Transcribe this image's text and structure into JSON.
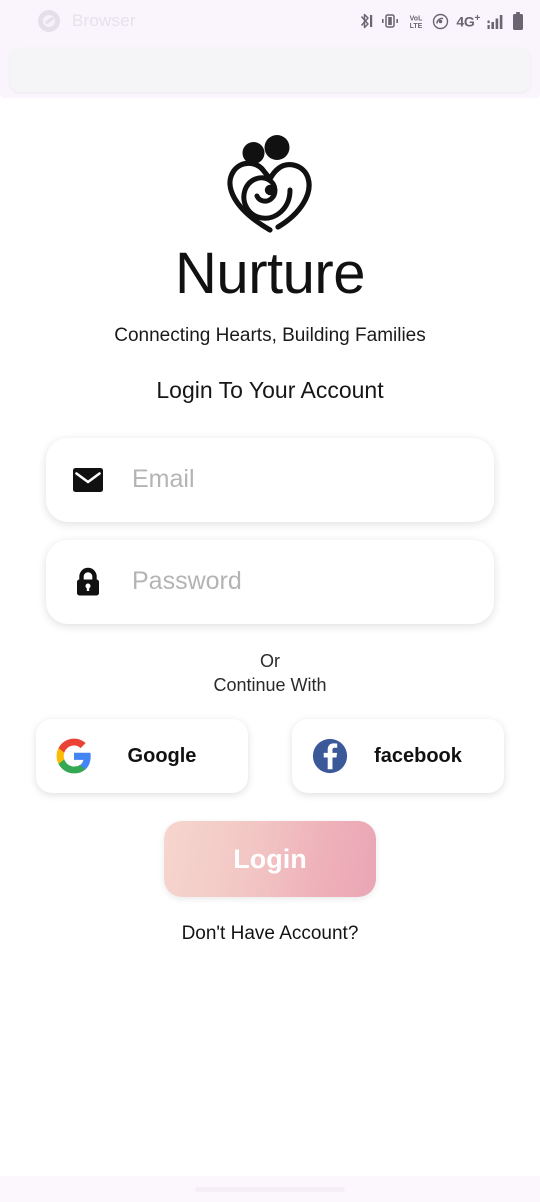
{
  "browser": {
    "label": "Browser",
    "compass_icon": "compass-icon",
    "url_bar_value": "",
    "url_bar_placeholder": "",
    "status_icons": [
      "bluetooth-off-icon",
      "vibrate-icon",
      "volte-icon",
      "hotspot-icon",
      "network-4g-plus-icon",
      "signal-bars-icon",
      "battery-icon"
    ],
    "network_label": "4G",
    "network_superscript": "+"
  },
  "app": {
    "logo_icon": "nurture-family-heart-logo",
    "brand_title": "Nurture",
    "tagline": "Connecting Hearts, Building Families",
    "section_heading": "Login To Your Account",
    "fields": [
      {
        "name": "email",
        "icon": "envelope-icon",
        "placeholder": "Email",
        "value": ""
      },
      {
        "name": "password",
        "icon": "lock-icon",
        "placeholder": "Password",
        "value": ""
      }
    ],
    "divider": {
      "line1": "Or",
      "line2": "Continue With"
    },
    "social_buttons": [
      {
        "name": "google",
        "icon": "google-g-icon",
        "label": "Google"
      },
      {
        "name": "facebook",
        "icon": "facebook-f-icon",
        "label": "facebook"
      }
    ],
    "login_button_label": "Login",
    "signup_link_label": "Don't Have Account?"
  },
  "colors": {
    "page_background": "#ffffff",
    "browser_chrome": "#faf5fc",
    "url_bar": "#f5f5f7",
    "login_gradient_start": "#f6d6ce",
    "login_gradient_end": "#e9a6b5",
    "google_blue": "#4285f4",
    "google_red": "#ea4335",
    "google_yellow": "#fbbc05",
    "google_green": "#34a853",
    "facebook_blue": "#3b5998",
    "placeholder_text": "#b4b4b4",
    "bottom_bar": "#fcf7fd"
  }
}
